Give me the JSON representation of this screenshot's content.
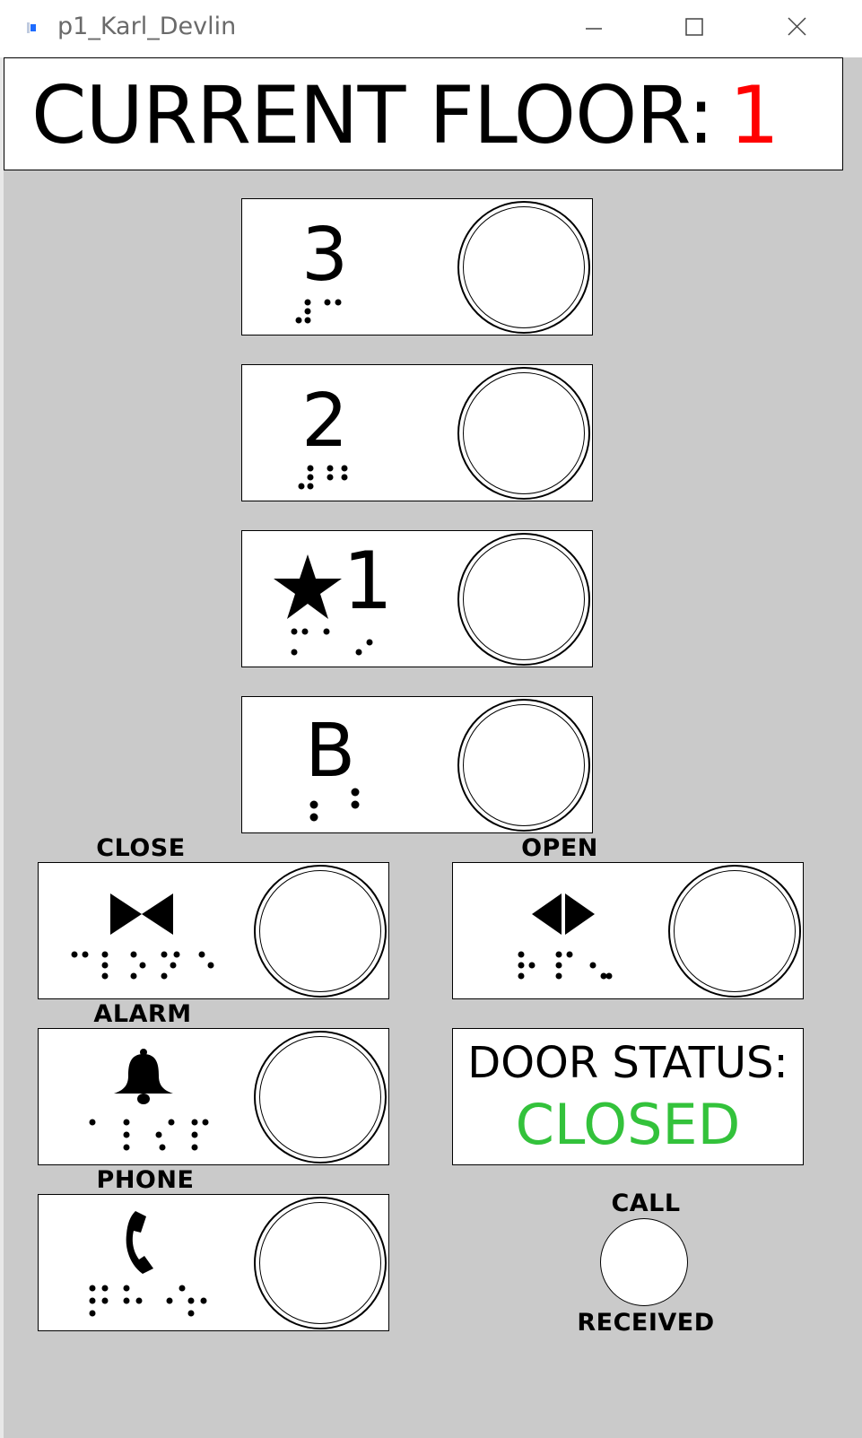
{
  "window": {
    "title": "p1_Karl_Devlin",
    "minimize_icon": "minimize-icon",
    "maximize_icon": "maximize-icon",
    "close_icon": "close-icon"
  },
  "header": {
    "label": "CURRENT FLOOR:",
    "value": "1",
    "value_color": "#ff0000"
  },
  "floor_buttons": [
    {
      "label": "3",
      "braille": "⠼⠉"
    },
    {
      "label": "2",
      "braille": "⠼⠃"
    },
    {
      "label": "1",
      "icon": "star-icon",
      "braille": "⠔⠀⠼⠁"
    },
    {
      "label": "B",
      "braille": "⠃"
    }
  ],
  "control_buttons": {
    "close": {
      "label": "CLOSE",
      "icon": "door-close-icon",
      "braille": "⠉⠇⠕⠎⠑"
    },
    "open": {
      "label": "OPEN",
      "icon": "door-open-icon",
      "braille": "⠕⠏⠑⠝"
    },
    "alarm": {
      "label": "ALARM",
      "icon": "bell-icon",
      "braille": "⠁⠇⠁⠗⠍"
    },
    "phone": {
      "label": "PHONE",
      "icon": "phone-icon",
      "braille": "⠏⠓⠕⠝⠑"
    }
  },
  "door_status": {
    "label": "DOOR STATUS:",
    "value": "CLOSED",
    "value_color": "#33c23b"
  },
  "call_indicator": {
    "top_label": "CALL",
    "bottom_label": "RECEIVED"
  }
}
